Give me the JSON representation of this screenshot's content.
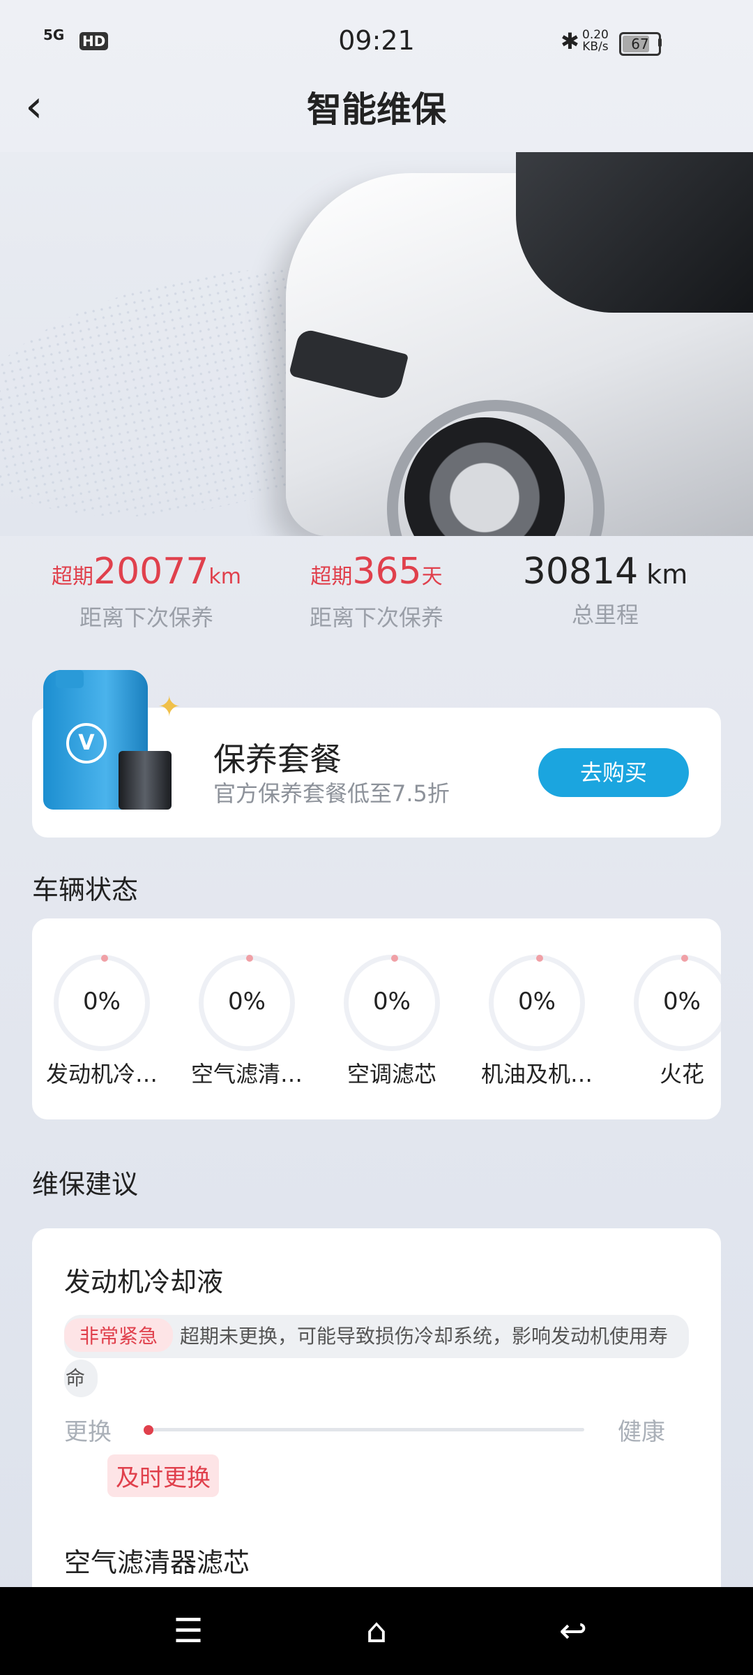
{
  "status_bar": {
    "network": "5G",
    "hd": "HD",
    "time": "09:21",
    "speed_value": "0.20",
    "speed_unit": "KB/s",
    "battery": "67"
  },
  "header": {
    "title": "智能维保"
  },
  "stats": [
    {
      "prefix": "超期",
      "value": "20077",
      "unit": "km",
      "label": "距离下次保养"
    },
    {
      "prefix": "超期",
      "value": "365",
      "unit": "天",
      "label": "距离下次保养"
    },
    {
      "prefix": "",
      "value": "30814",
      "unit": " km",
      "label": "总里程"
    }
  ],
  "package": {
    "title": "保养套餐",
    "subtitle": "官方保养套餐低至7.5折",
    "button": "去购买"
  },
  "vehicle_status": {
    "title": "车辆状态",
    "items": [
      {
        "percent": "0%",
        "label": "发动机冷…"
      },
      {
        "percent": "0%",
        "label": "空气滤清…"
      },
      {
        "percent": "0%",
        "label": "空调滤芯"
      },
      {
        "percent": "0%",
        "label": "机油及机…"
      },
      {
        "percent": "0%",
        "label": "火花"
      }
    ]
  },
  "advice": {
    "title": "维保建议",
    "items": [
      {
        "name": "发动机冷却液",
        "urgency": "非常紧急",
        "description": "超期未更换，可能导致损伤冷却系统，影响发动机使用寿",
        "description_cont": "命",
        "left_label": "更换",
        "right_label": "健康",
        "action": "及时更换"
      },
      {
        "name": "空气滤清器滤芯"
      }
    ]
  }
}
